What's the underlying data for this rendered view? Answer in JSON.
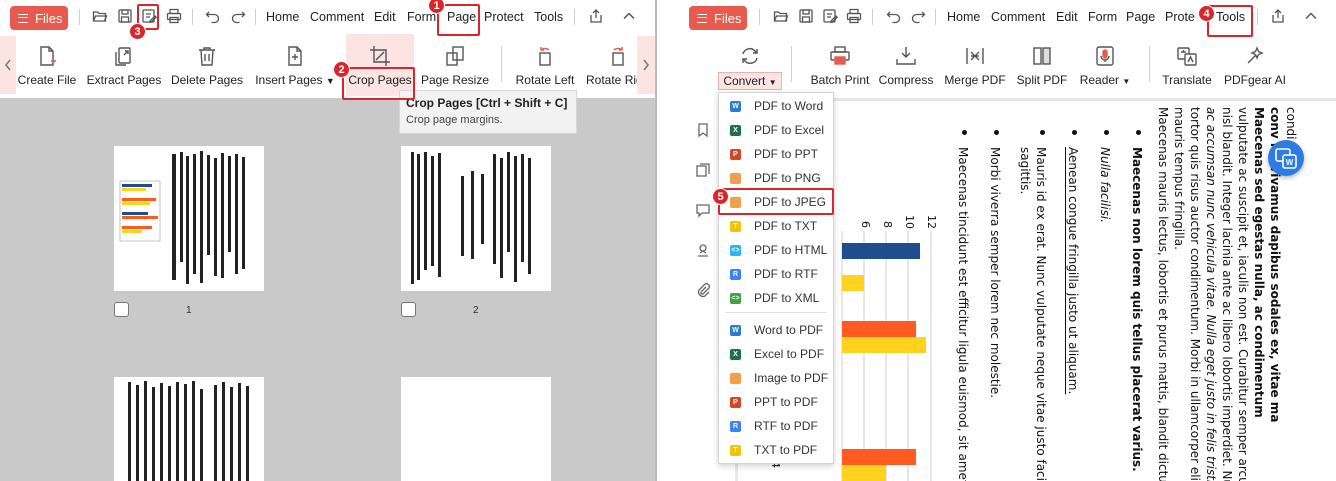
{
  "left_app": {
    "files_label": "Files",
    "menu": [
      "Home",
      "Comment",
      "Edit",
      "Form",
      "Page",
      "Protect",
      "Tools"
    ],
    "ribbon": [
      "Create File",
      "Extract Pages",
      "Delete Pages",
      "Insert Pages",
      "Crop Pages",
      "Page Resize",
      "Rotate Left",
      "Rotate Rig"
    ],
    "tooltip": {
      "title": "Crop Pages  [Ctrl + Shift + C]",
      "desc": "Crop page margins."
    },
    "page_numbers": [
      "1",
      "2"
    ]
  },
  "right_app": {
    "files_label": "Files",
    "menu": [
      "Home",
      "Comment",
      "Edit",
      "Form",
      "Page",
      "Prote",
      "Tools"
    ],
    "ribbon": [
      "Convert",
      "Batch Print",
      "Compress",
      "Merge PDF",
      "Split PDF",
      "Reader",
      "Translate",
      "PDFgear AI"
    ],
    "convert_menu": [
      {
        "label": "PDF to Word",
        "icon": "W",
        "color": "#2b7cd3"
      },
      {
        "label": "PDF to Excel",
        "icon": "X",
        "color": "#1e7145"
      },
      {
        "label": "PDF to PPT",
        "icon": "P",
        "color": "#d24726"
      },
      {
        "label": "PDF to PNG",
        "icon": "",
        "color": "#f0a04b"
      },
      {
        "label": "PDF to JPEG",
        "icon": "",
        "color": "#f0a04b"
      },
      {
        "label": "PDF to TXT",
        "icon": "T",
        "color": "#f4c20d"
      },
      {
        "label": "PDF to HTML",
        "icon": "<>",
        "color": "#29b6f6"
      },
      {
        "label": "PDF to RTF",
        "icon": "R",
        "color": "#3b82f6"
      },
      {
        "label": "PDF to XML",
        "icon": "<>",
        "color": "#43a047"
      },
      {
        "label": "Word to PDF",
        "icon": "W",
        "color": "#2b7cd3"
      },
      {
        "label": "Excel to PDF",
        "icon": "X",
        "color": "#1e7145"
      },
      {
        "label": "Image to PDF",
        "icon": "",
        "color": "#f0a04b"
      },
      {
        "label": "PPT to PDF",
        "icon": "P",
        "color": "#d24726"
      },
      {
        "label": "RTF to PDF",
        "icon": "R",
        "color": "#3b82f6"
      },
      {
        "label": "TXT to PDF",
        "icon": "T",
        "color": "#f4c20d"
      }
    ],
    "document_text": [
      "condi",
      "conv    m. Vivamus dapibus sodales ex, vitae ma",
      "Maecenas sed egestas nulla, ac condimentum",
      "vulputate ac suscipit et, iaculis non est. Curabitur semper arcu ac",
      "nisl blandit. Integer lacinia ante ac libero lobortis imperdiet. Nul",
      "ac accumsan nunc vehicula vitae. Nulla eget justo in felis tristiq",
      "tortor quis risus auctor condimentum. Morbi in ullamcorper elit",
      "mauris tempus fringilla.",
      "Maecenas mauris lectus, lobortis et purus mattis, blandit dictum",
      "Maecenas non lorem quis tellus placerat varius.",
      "Nulla facilisi.",
      "Aenean congue fringilla justo ut aliquam.",
      "Mauris id ex erat. Nunc vulputate neque vitae justo facilis",
      "sagittis.",
      "Morbi viverra semper lorem nec molestie.",
      "Maecenas tincidunt est efficitur ligula euismod, sit amet c"
    ],
    "chart_ticks": [
      "12",
      "10",
      "8",
      "6",
      "4"
    ]
  },
  "steps": [
    "1",
    "2",
    "3",
    "4",
    "5"
  ],
  "colors": {
    "accent": "#e95a4e",
    "highlight": "#d9252b",
    "bar_blue": "#1f4e8c",
    "bar_orange": "#ff5a1f",
    "bar_yellow": "#ffd21f"
  }
}
